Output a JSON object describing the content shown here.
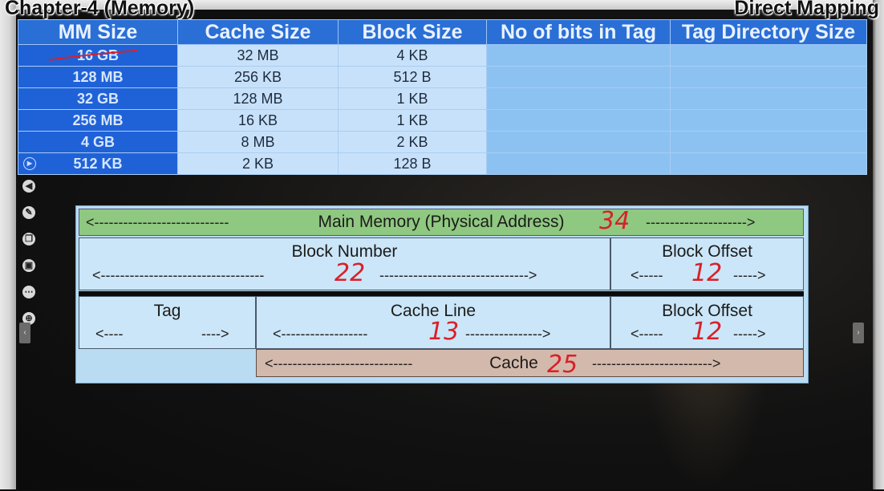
{
  "captions": {
    "left": "Chapter-4 (Memory)",
    "right": "Direct Mapping"
  },
  "table": {
    "headers": [
      "MM Size",
      "Cache Size",
      "Block Size",
      "No of bits in Tag",
      "Tag Directory Size"
    ],
    "rows": [
      [
        "16 GB",
        "32 MB",
        "4 KB",
        "",
        ""
      ],
      [
        "128 MB",
        "256 KB",
        "512 B",
        "",
        ""
      ],
      [
        "32 GB",
        "128 MB",
        "1 KB",
        "",
        ""
      ],
      [
        "256 MB",
        "16 KB",
        "1 KB",
        "",
        ""
      ],
      [
        "4 GB",
        "8 MB",
        "2 KB",
        "",
        ""
      ],
      [
        "512 KB",
        "2 KB",
        "128 B",
        "",
        ""
      ]
    ]
  },
  "diagram": {
    "main_memory_label": "Main Memory (Physical Address)",
    "main_memory_bits": "34",
    "block_number_label": "Block Number",
    "block_number_bits": "22",
    "block_offset_label": "Block Offset",
    "block_offset_bits": "12",
    "tag_label": "Tag",
    "cache_line_label": "Cache Line",
    "cache_line_bits": "13",
    "block_offset_label_2": "Block Offset",
    "block_offset_bits_2": "12",
    "cache_label": "Cache",
    "cache_bits": "25"
  },
  "toolbar_icons": [
    "back-icon",
    "pen-icon",
    "copy-icon",
    "screen-icon",
    "more-icon",
    "zoom-icon"
  ],
  "colors": {
    "header_blue": "#2a6fd6",
    "mm_column_blue": "#1f62d8",
    "main_memory_green": "#8fc880",
    "cache_band": "#d3b9ab",
    "handwriting_red": "#d8202a"
  }
}
